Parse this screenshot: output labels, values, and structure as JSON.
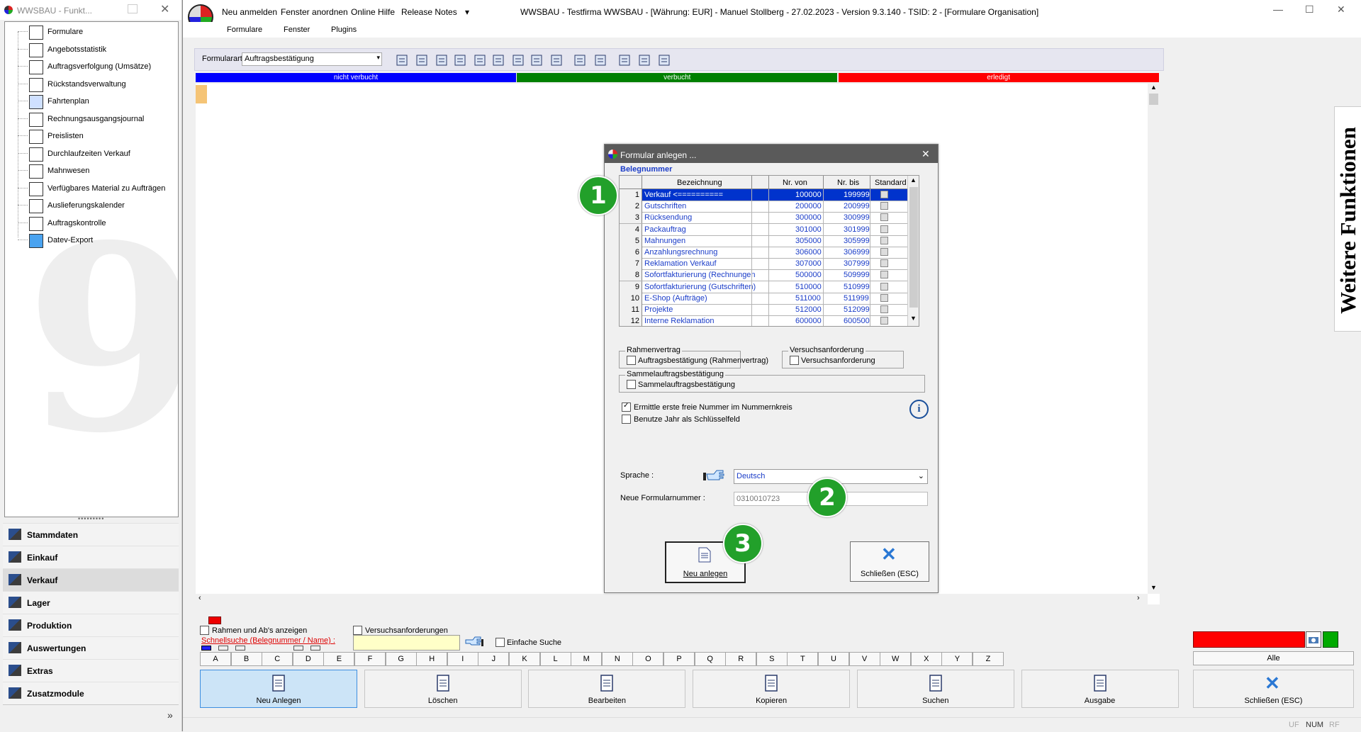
{
  "left_panel": {
    "window_title": "WWSBAU - Funkt...",
    "tree_items": [
      {
        "label": "Formulare",
        "icon": "form-icon"
      },
      {
        "label": "Angebotsstatistik",
        "icon": "statistics-icon"
      },
      {
        "label": "Auftragsverfolgung (Umsätze)",
        "icon": "tracking-icon"
      },
      {
        "label": "Rückstandsverwaltung",
        "icon": "backlog-icon"
      },
      {
        "label": "Fahrtenplan",
        "icon": "truck-icon"
      },
      {
        "label": "Rechnungsausgangsjournal",
        "icon": "journal-icon"
      },
      {
        "label": "Preislisten",
        "icon": "price-tag-icon"
      },
      {
        "label": "Durchlaufzeiten Verkauf",
        "icon": "hourglass-icon"
      },
      {
        "label": "Mahnwesen",
        "icon": "dunning-icon"
      },
      {
        "label": "Verfügbares Material zu Aufträgen",
        "icon": "material-icon"
      },
      {
        "label": "Auslieferungskalender",
        "icon": "calendar-icon"
      },
      {
        "label": "Auftragskontrolle",
        "icon": "order-control-icon"
      },
      {
        "label": "Datev-Export",
        "icon": "datev-icon"
      }
    ],
    "watermark": "9",
    "nav": [
      {
        "label": "Stammdaten",
        "icon": "master-data-icon"
      },
      {
        "label": "Einkauf",
        "icon": "purchase-icon"
      },
      {
        "label": "Verkauf",
        "icon": "sales-icon",
        "active": true
      },
      {
        "label": "Lager",
        "icon": "warehouse-icon"
      },
      {
        "label": "Produktion",
        "icon": "production-icon"
      },
      {
        "label": "Auswertungen",
        "icon": "reports-icon"
      },
      {
        "label": "Extras",
        "icon": "extras-icon"
      },
      {
        "label": "Zusatzmodule",
        "icon": "modules-icon"
      }
    ],
    "more": "»"
  },
  "main": {
    "top_menu": [
      "Neu anmelden",
      "Fenster anordnen",
      "Online Hilfe",
      "Release Notes",
      "▾"
    ],
    "window_title": "WWSBAU - Testfirma WWSBAU - [Währung: EUR] - Manuel Stollberg - 27.02.2023 - Version 9.3.140 - TSID: 2  - [Formulare Organisation]",
    "window_controls": [
      "—",
      "☐",
      "✕"
    ],
    "ribbon_tabs": [
      "Formulare",
      "Fenster",
      "Plugins"
    ],
    "toolbar": {
      "formularart_label": "Formularart:",
      "formularart_value": "Auftragsbestätigung"
    },
    "status_strip": [
      {
        "label": "nicht verbucht",
        "color": "#0000ff"
      },
      {
        "label": "verbucht",
        "color": "#008000"
      },
      {
        "label": "erledigt",
        "color": "#ff0000"
      }
    ],
    "side_tab": "Weitere Funktionen"
  },
  "dialog": {
    "title": "Formular anlegen ...",
    "section": "Belegnummer",
    "columns": [
      "Bezeichnung",
      "Nr. von",
      "Nr. bis",
      "Standard"
    ],
    "rows": [
      {
        "n": "1",
        "name": "Verkauf  <==========",
        "von": "100000",
        "bis": "199999",
        "selected": true
      },
      {
        "n": "2",
        "name": "Gutschriften",
        "von": "200000",
        "bis": "200999"
      },
      {
        "n": "3",
        "name": "Rücksendung",
        "von": "300000",
        "bis": "300999"
      },
      {
        "n": "4",
        "name": "Packauftrag",
        "von": "301000",
        "bis": "301999"
      },
      {
        "n": "5",
        "name": "Mahnungen",
        "von": "305000",
        "bis": "305999"
      },
      {
        "n": "6",
        "name": "Anzahlungsrechnung",
        "von": "306000",
        "bis": "306999"
      },
      {
        "n": "7",
        "name": "Reklamation Verkauf",
        "von": "307000",
        "bis": "307999"
      },
      {
        "n": "8",
        "name": "Sofortfakturierung (Rechnungen",
        "von": "500000",
        "bis": "509999"
      },
      {
        "n": "9",
        "name": "Sofortfakturierung (Gutschriften)",
        "von": "510000",
        "bis": "510999"
      },
      {
        "n": "10",
        "name": "E-Shop (Aufträge)",
        "von": "511000",
        "bis": "511999"
      },
      {
        "n": "11",
        "name": "Projekte",
        "von": "512000",
        "bis": "512099"
      },
      {
        "n": "12",
        "name": "Interne Reklamation",
        "von": "600000",
        "bis": "600500"
      }
    ],
    "rahmenvertrag": {
      "title": "Rahmenvertrag",
      "checkbox": "Auftragsbestätigung (Rahmenvertrag)"
    },
    "versuchsanforderung": {
      "title": "Versuchsanforderung",
      "checkbox": "Versuchsanforderung"
    },
    "sammel": {
      "title": "Sammelauftragsbestätigung",
      "checkbox": "Sammelauftragsbestätigung"
    },
    "option_first_free": "Ermittle erste freie Nummer im Nummernkreis",
    "option_year_key": "Benutze Jahr als Schlüsselfeld",
    "sprache_label": "Sprache :",
    "sprache_value": "Deutsch",
    "neue_nr_label": "Neue Formularnummer :",
    "neue_nr_value": "0310010723",
    "btn_new": "Neu anlegen",
    "btn_close": "Schließen (ESC)",
    "markers": [
      "1",
      "2",
      "3"
    ]
  },
  "bottom": {
    "rahmen_check": "Rahmen und Ab's anzeigen",
    "versuch_check": "Versuchsanforderungen",
    "schnellsuche_label": "Schnellsuche (Belegnummer / Name) :",
    "einfache_suche": "Einfache Suche",
    "letters": [
      "A",
      "B",
      "C",
      "D",
      "E",
      "F",
      "G",
      "H",
      "I",
      "J",
      "K",
      "L",
      "M",
      "N",
      "O",
      "P",
      "Q",
      "R",
      "S",
      "T",
      "U",
      "V",
      "W",
      "X",
      "Y",
      "Z"
    ],
    "alle": "Alle",
    "actions": [
      {
        "label": "Neu Anlegen",
        "icon": "new-document-icon",
        "active": true
      },
      {
        "label": "Löschen",
        "icon": "trash-icon"
      },
      {
        "label": "Bearbeiten",
        "icon": "edit-icon"
      },
      {
        "label": "Kopieren",
        "icon": "copy-icon"
      },
      {
        "label": "Suchen",
        "icon": "binoculars-icon"
      },
      {
        "label": "Ausgabe",
        "icon": "printer-icon"
      }
    ],
    "close_label": "Schließen (ESC)",
    "status_indicators": [
      "UF",
      "NUM",
      "RF"
    ]
  }
}
